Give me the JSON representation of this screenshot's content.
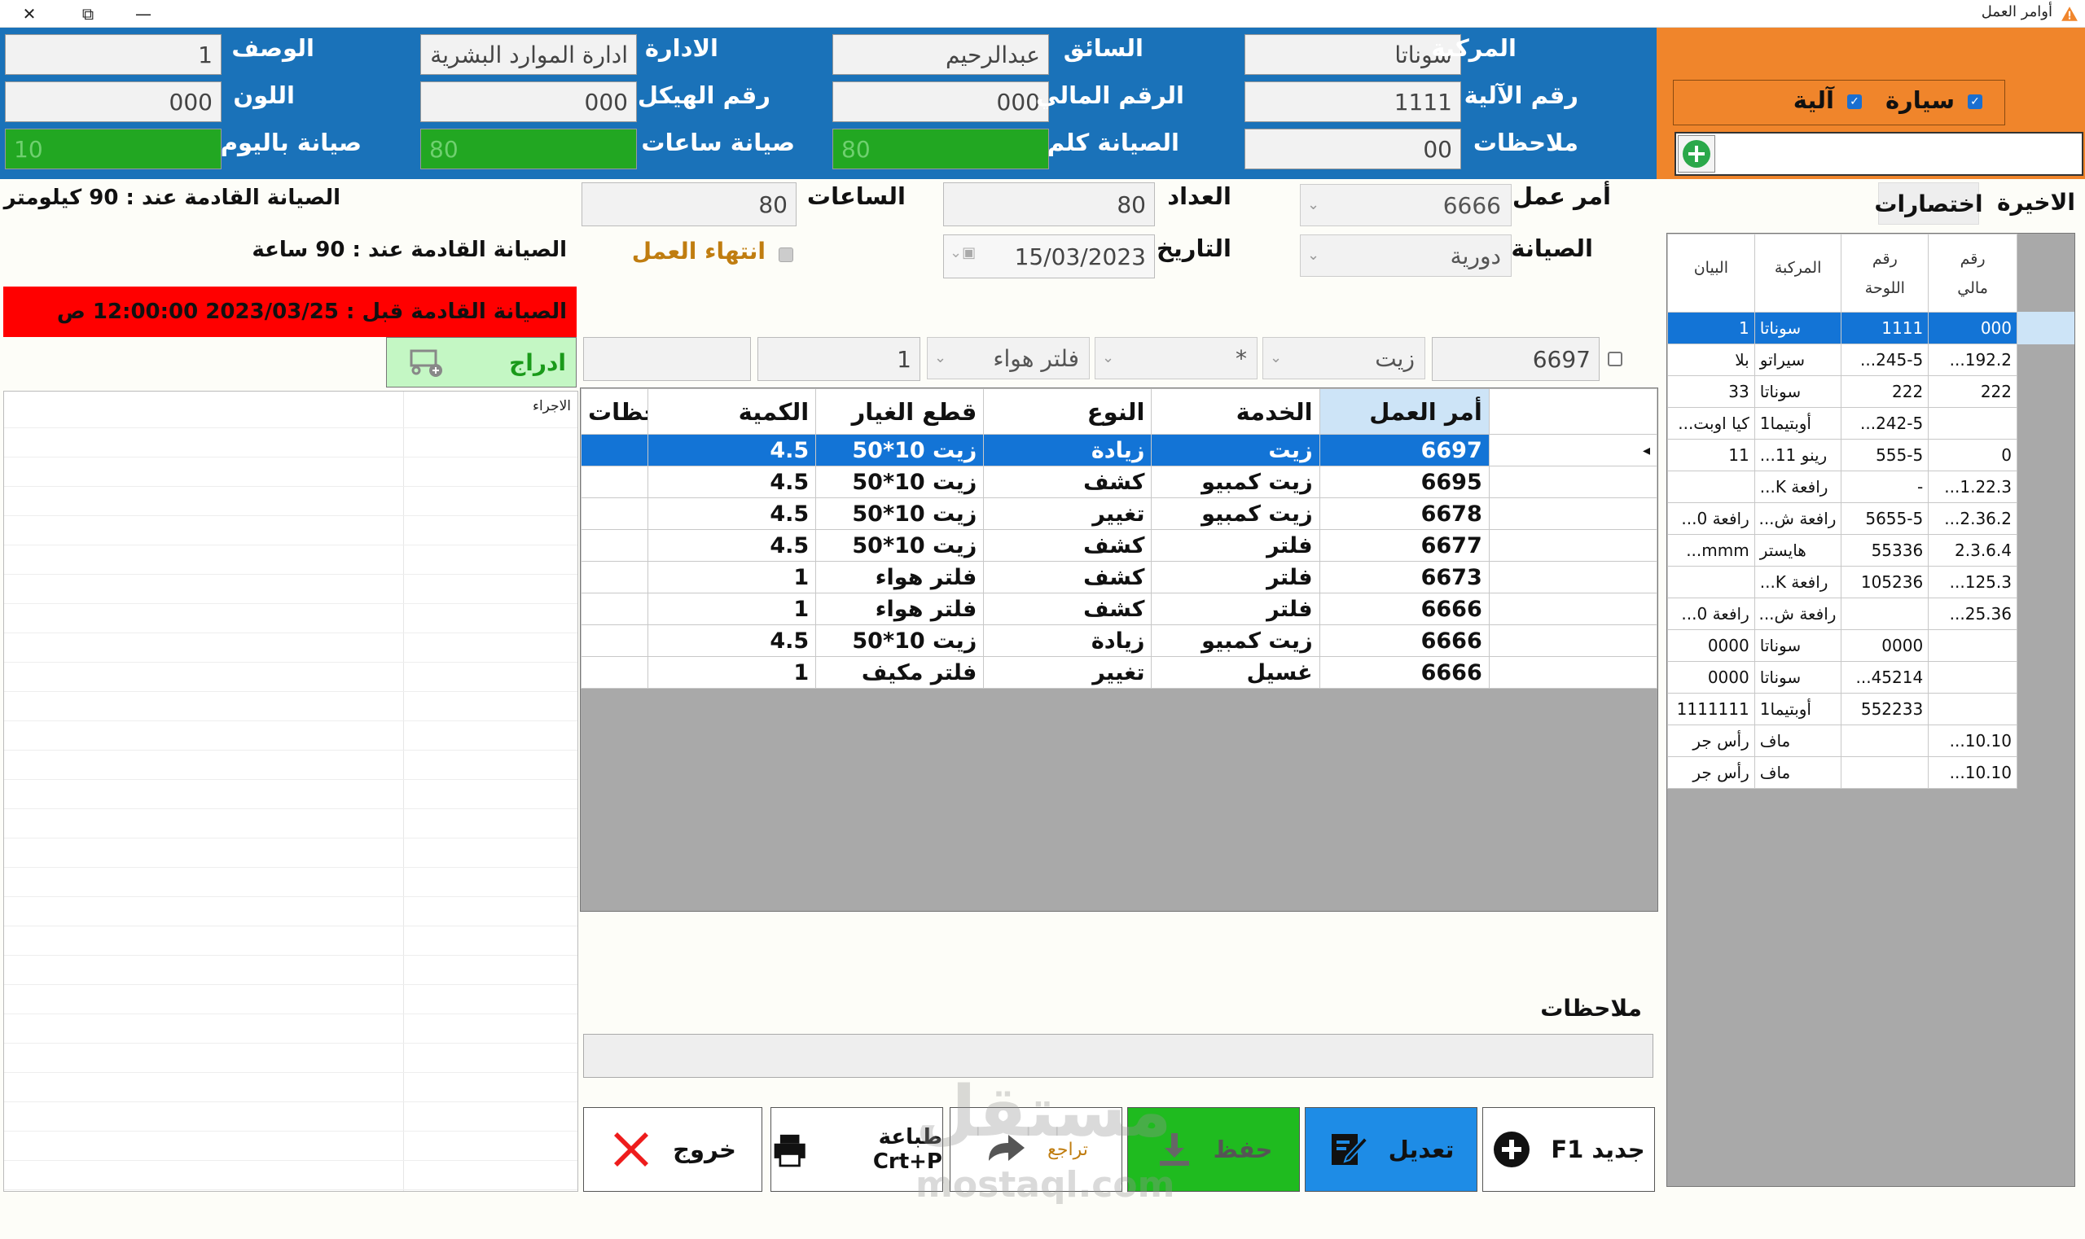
{
  "window": {
    "title": "أوامر العمل",
    "close": "✕",
    "restore": "⧉",
    "minimize": "—"
  },
  "vehicle": {
    "labels": {
      "description": "الوصف",
      "department": "الادارة",
      "driver": "السائق",
      "vehicle": "المركبة",
      "color": "اللون",
      "chassis": "رقم الهيكل",
      "financial": "الرقم المالي",
      "machine_no": "رقم الآلية",
      "daily_maint": "صيانة باليوم",
      "hours_maint": "صيانة ساعات",
      "km_maint": "الصيانة كلم",
      "notes": "ملاحظات"
    },
    "values": {
      "description": "1",
      "department": "ادارة الموارد البشرية",
      "driver": "عبدالرحيم",
      "vehicle": "سوناتا",
      "color": "000",
      "chassis": "000",
      "financial": "000",
      "machine_no": "1111",
      "daily_maint": "10",
      "hours_maint": "80",
      "km_maint": "80",
      "notes": "00"
    }
  },
  "type_selector": {
    "car": "سيارة",
    "machine": "آلية",
    "search_value": ""
  },
  "work": {
    "labels": {
      "hours": "الساعات",
      "counter": "العداد",
      "order": "أمر عمل",
      "date": "التاريخ",
      "maintenance": "الصيانة",
      "end_work": "انتهاء العمل"
    },
    "values": {
      "hours": "80",
      "counter": "80",
      "order": "6666",
      "date": "15/03/2023",
      "maintenance": "دورية"
    },
    "next_km": "الصيانة القادمة عند : 90 كيلومتر",
    "next_hours": "الصيانة القادمة عند : 90 ساعة",
    "alert": "الصيانة القادمة قبل : 2023/03/25 12:00:00 ص"
  },
  "right_tabs": {
    "last": "الاخيرة",
    "shortcuts": "اختصارات"
  },
  "entry_row": {
    "order": "6697",
    "service": "زيت",
    "type": "*",
    "part": "فلتر هواء",
    "qty": "1",
    "notes": "",
    "insert": "ادراج"
  },
  "main_grid": {
    "headers": [
      "أمر العمل",
      "الخدمة",
      "النوع",
      "قطع الغيار",
      "الكمية",
      "ملاحظات"
    ],
    "rows": [
      [
        "6697",
        "زيت",
        "زيادة",
        "زيت 10*50",
        "4.5",
        ""
      ],
      [
        "6695",
        "زيت كمبيو",
        "كشف",
        "زيت 10*50",
        "4.5",
        ""
      ],
      [
        "6678",
        "زيت كمبيو",
        "تغيير",
        "زيت 10*50",
        "4.5",
        ""
      ],
      [
        "6677",
        "فلتر",
        "كشف",
        "زيت 10*50",
        "4.5",
        ""
      ],
      [
        "6673",
        "فلتر",
        "كشف",
        "فلتر هواء",
        "1",
        ""
      ],
      [
        "6666",
        "فلتر",
        "كشف",
        "فلتر هواء",
        "1",
        ""
      ],
      [
        "6666",
        "زيت كمبيو",
        "زيادة",
        "زيت 10*50",
        "4.5",
        ""
      ],
      [
        "6666",
        "غسيل",
        "تغيير",
        "فلتر مكيف",
        "1",
        ""
      ]
    ]
  },
  "right_grid": {
    "headers": [
      [
        "رقم",
        "مالي"
      ],
      [
        "رقم",
        "اللوحة"
      ],
      [
        "المركبة",
        ""
      ],
      [
        "البيان",
        ""
      ]
    ],
    "rows": [
      [
        "000",
        "1111",
        "سوناتا",
        "1"
      ],
      [
        "192.2...",
        "245-5...",
        "سيراتو",
        "بلا"
      ],
      [
        "222",
        "222",
        "سوناتا",
        "33"
      ],
      [
        "",
        "242-5...",
        "أوبتيما1",
        "كيا اوبت..."
      ],
      [
        "0",
        "555-5",
        "رينو 11...",
        "11"
      ],
      [
        "1.22.3...",
        "-",
        "رافعة K...",
        ""
      ],
      [
        "2.36.2...",
        "5655-5",
        "رافعة ش...",
        "رافعة 0..."
      ],
      [
        "2.3.6.4",
        "55336",
        "هايستر",
        "mmm..."
      ],
      [
        "125.3...",
        "105236",
        "رافعة K...",
        ""
      ],
      [
        "25.36...",
        "",
        "رافعة ش...",
        "رافعة 0..."
      ],
      [
        "",
        "0000",
        "سوناتا",
        "0000"
      ],
      [
        "",
        "45214...",
        "سوناتا",
        "0000"
      ],
      [
        "",
        "552233",
        "أوبتيما1",
        "1111111"
      ],
      [
        "10.10...",
        "",
        "ماف",
        "رأس جر"
      ],
      [
        "10.10...",
        "",
        "ماف",
        "رأس جر"
      ]
    ]
  },
  "procedures": {
    "header": "الاجراء"
  },
  "notes_section": {
    "label": "ملاحظات",
    "value": ""
  },
  "buttons": {
    "new": "جديد F1",
    "edit": "تعديل",
    "save": "حفظ",
    "undo": "تراجع",
    "print": "طباعة Crt+P",
    "exit": "خروج"
  },
  "watermark": {
    "ar": "مستقل",
    "en": "mostaql.com"
  },
  "colors": {
    "blue": "#1a72b9",
    "orange": "#f0852b",
    "green": "#22a722",
    "red": "#ff0000",
    "select": "#1374d6"
  }
}
